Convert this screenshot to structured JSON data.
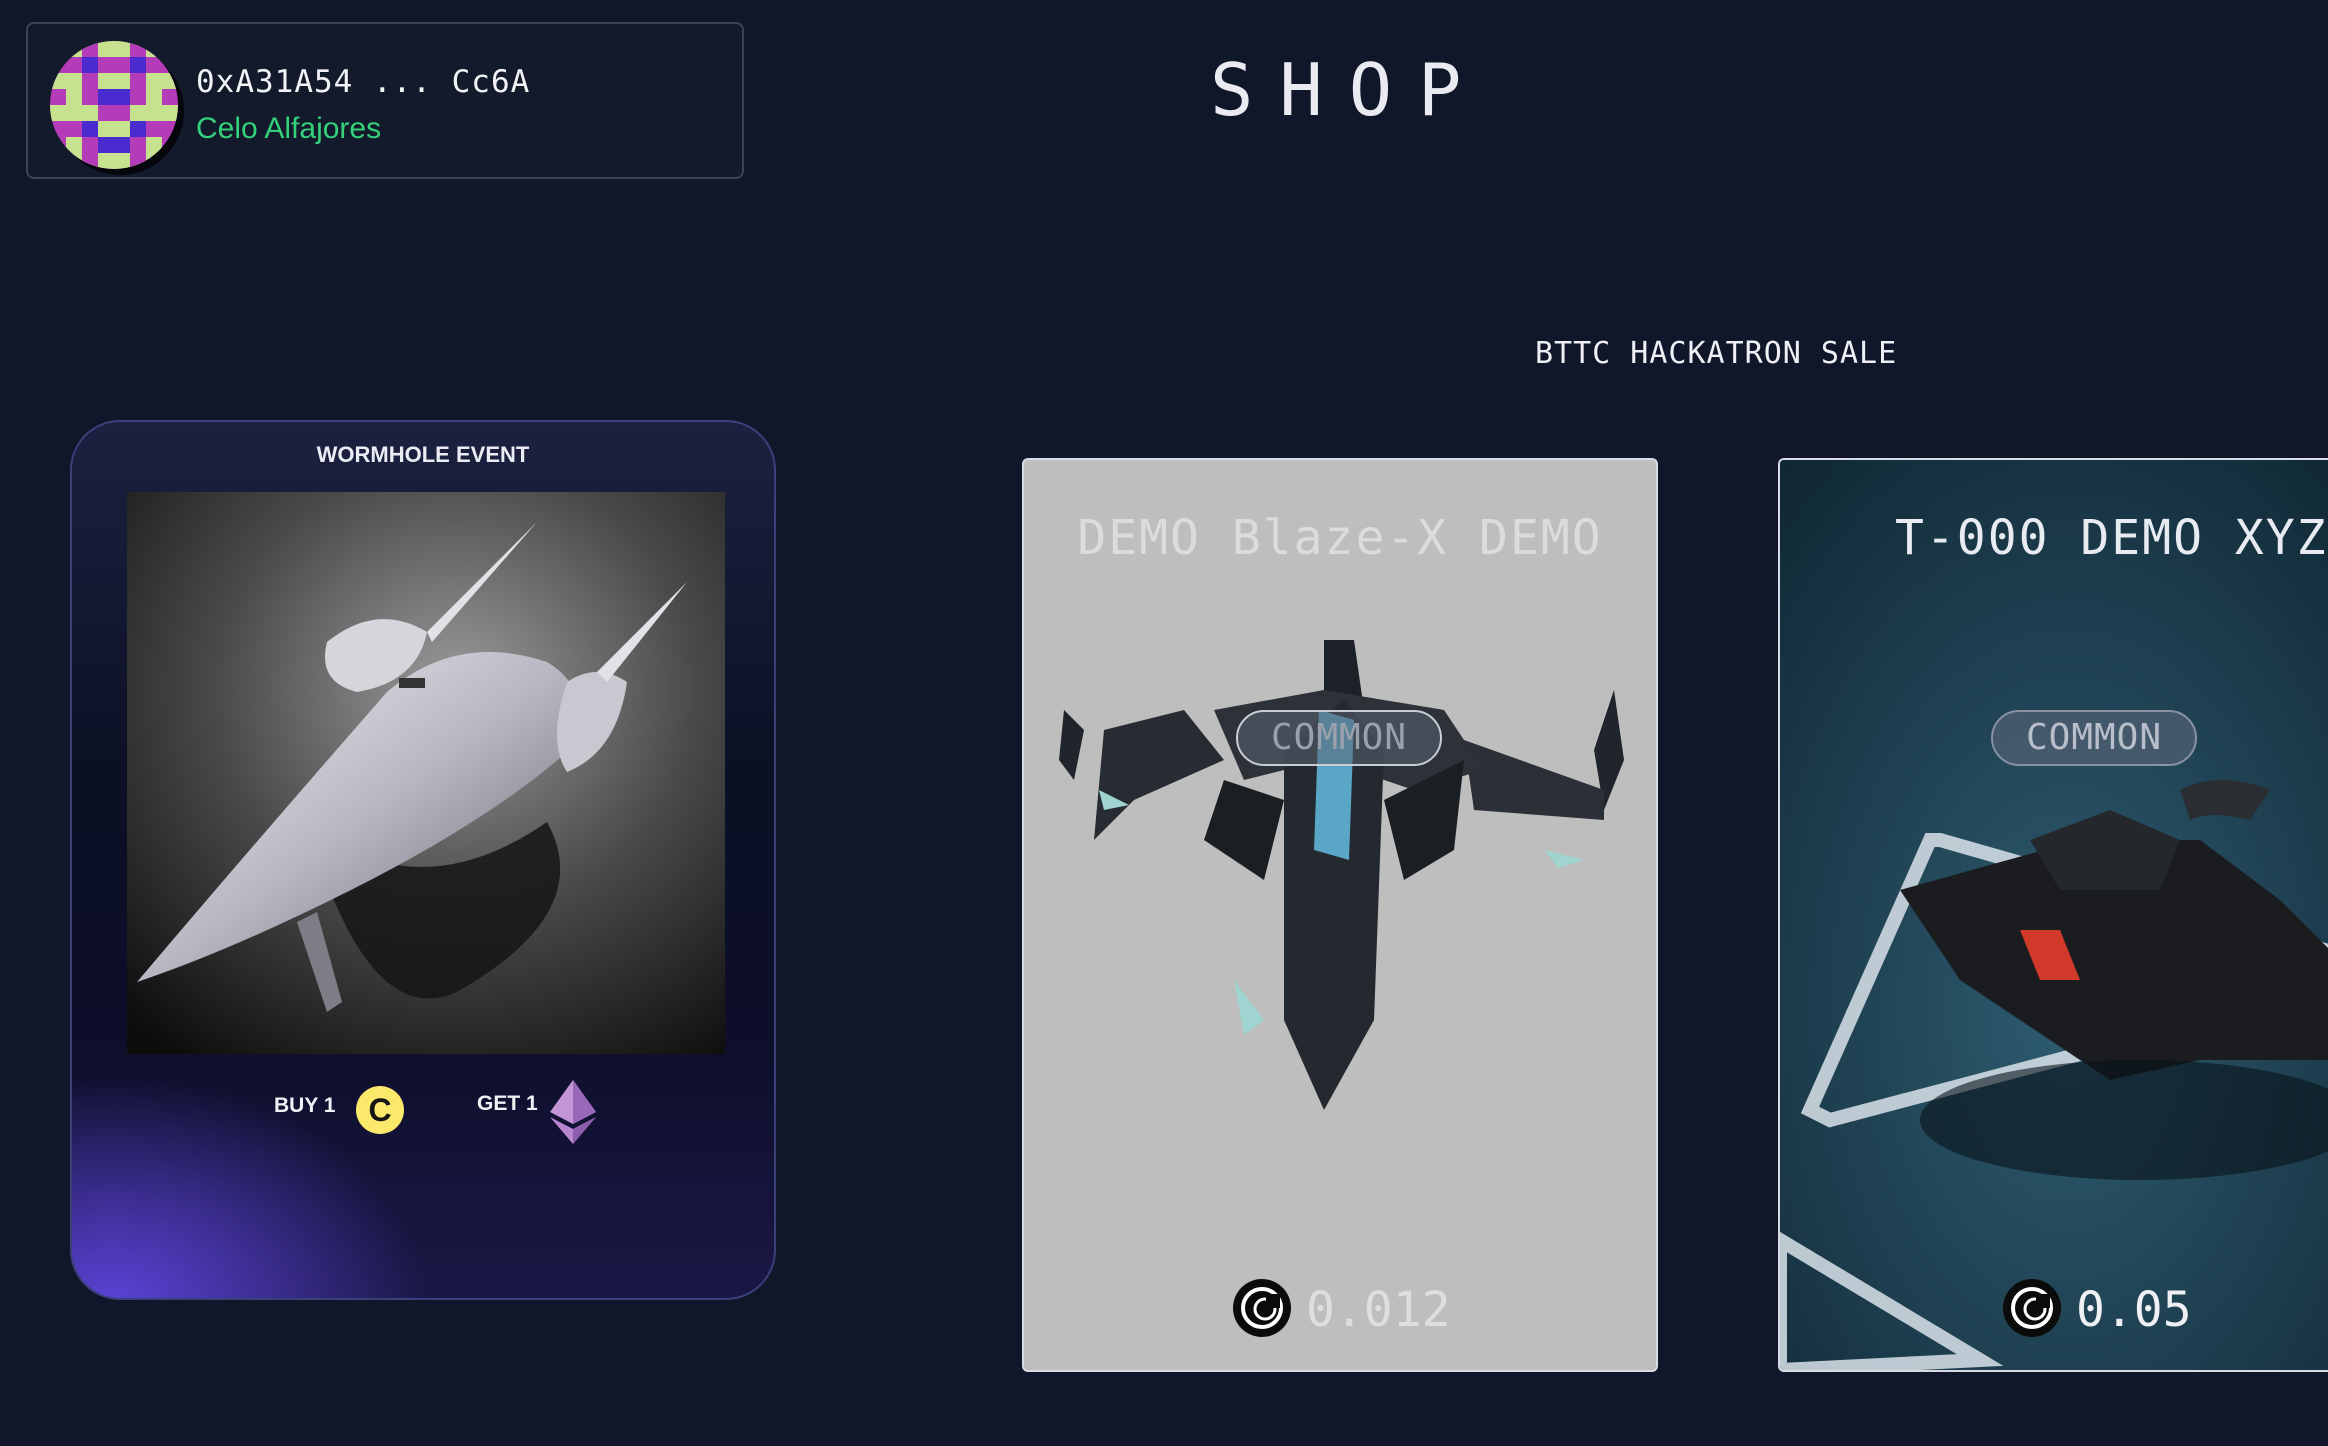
{
  "wallet": {
    "address": "0xA31A54 ... Cc6A",
    "network": "Celo Alfajores",
    "network_color": "#35d07a"
  },
  "page": {
    "title": "SHOP"
  },
  "event_card": {
    "title": "WORMHOLE EVENT",
    "buy_label": "BUY 1",
    "buy_coin_letter": "C",
    "get_label": "GET 1",
    "buy_coin_icon": "celo-coin-icon",
    "get_coin_icon": "ethereum-icon"
  },
  "sale": {
    "title": "BTTC HACKATRON SALE",
    "items": [
      {
        "name": "DEMO Blaze-X DEMO",
        "rarity": "COMMON",
        "price": "0.012",
        "currency_icon": "bttc-coin-icon"
      },
      {
        "name": "T-000 DEMO XYZ",
        "rarity": "COMMON",
        "price": "0.05",
        "currency_icon": "bttc-coin-icon"
      }
    ]
  },
  "colors": {
    "background": "#11172a",
    "event_glow": "#5a43d6",
    "card1_bg": "#bebebe",
    "card2_bg": "#1b3a4c"
  }
}
